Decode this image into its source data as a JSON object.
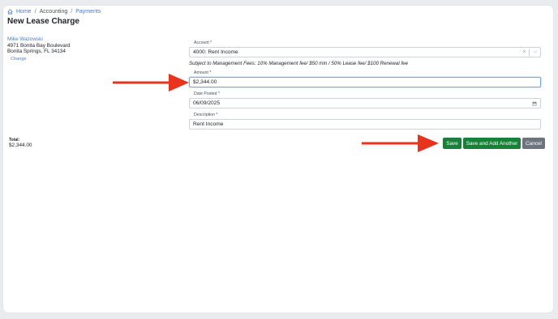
{
  "breadcrumb": {
    "home": "Home",
    "accounting": "Accounting",
    "payments": "Payments",
    "separator": "/"
  },
  "page": {
    "title": "New Lease Charge"
  },
  "tenant": {
    "name": "Mike Wazowski",
    "address_line1": "4971 Bonita Bay Boulevard",
    "address_line2": "Bonita Springs, FL 34134",
    "change_label": "Change"
  },
  "form": {
    "account": {
      "label": "Account *",
      "value": "4000: Rent Income"
    },
    "fee_note": "Subject to Management Fees: 10% Management fee/ $50 min / 50% Lease fee/ $100 Renewal fee",
    "amount": {
      "label": "Amount *",
      "value": "$2,344.00"
    },
    "date_posted": {
      "label": "Date Posted *",
      "value": "06/09/2025"
    },
    "description": {
      "label": "Description *",
      "value": "Rent Income"
    }
  },
  "total": {
    "label": "Total:",
    "value": "$2,344.00"
  },
  "buttons": {
    "save": "Save",
    "save_add": "Save and Add Another",
    "cancel": "Cancel"
  },
  "colors": {
    "link": "#4a7bd0",
    "success": "#198038",
    "secondary": "#6c757d",
    "annotation_arrow": "#e8341c"
  }
}
